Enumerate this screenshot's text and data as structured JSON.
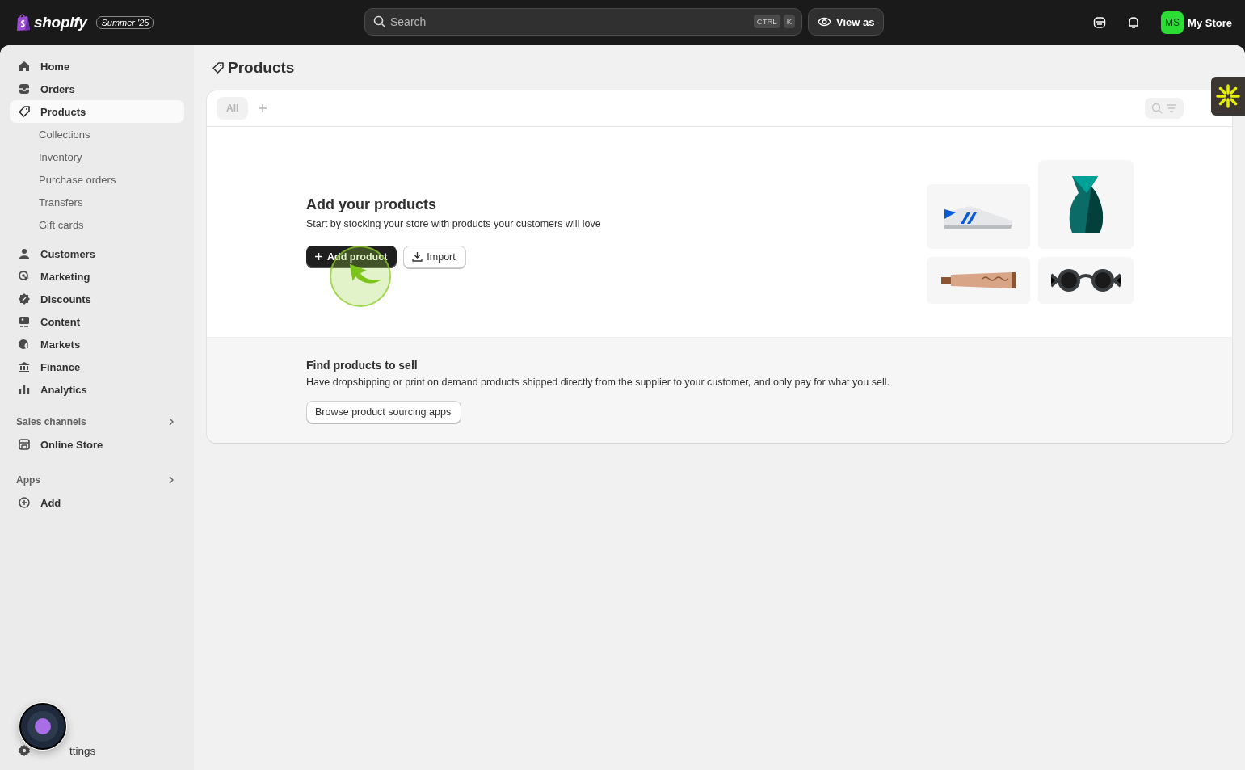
{
  "topbar": {
    "logo_text": "shopify",
    "edition_badge": "Summer '25",
    "search": {
      "placeholder": "Search"
    },
    "shortcut_keys": [
      "CTRL",
      "K"
    ],
    "view_as": "View as",
    "avatar_initials": "MS",
    "store_name": "My Store"
  },
  "sidebar": {
    "items": [
      {
        "label": "Home",
        "selected": false
      },
      {
        "label": "Orders",
        "selected": false
      },
      {
        "label": "Products",
        "selected": true,
        "children": [
          {
            "label": "Collections",
            "selected": false
          },
          {
            "label": "Inventory",
            "selected": false
          },
          {
            "label": "Purchase orders",
            "selected": false
          },
          {
            "label": "Transfers",
            "selected": false
          },
          {
            "label": "Gift cards",
            "selected": false
          }
        ]
      },
      {
        "label": "Customers",
        "selected": false
      },
      {
        "label": "Marketing",
        "selected": false
      },
      {
        "label": "Discounts",
        "selected": false
      },
      {
        "label": "Content",
        "selected": false
      },
      {
        "label": "Markets",
        "selected": false
      },
      {
        "label": "Finance",
        "selected": false
      },
      {
        "label": "Analytics",
        "selected": false
      }
    ],
    "sections": [
      {
        "title": "Sales channels",
        "items": [
          {
            "label": "Online Store",
            "selected": false
          }
        ]
      },
      {
        "title": "Apps",
        "items": [
          {
            "label": "Add",
            "selected": false
          }
        ]
      }
    ],
    "footer_item": {
      "label": "ttings"
    }
  },
  "page": {
    "title": "Products",
    "card": {
      "tabs": [
        {
          "label": "All",
          "selected": true
        }
      ],
      "empty_state": {
        "heading": "Add your products",
        "text": "Start by stocking your store with products your customers will love",
        "buttons": [
          {
            "label": "Add product",
            "kind": "primary"
          },
          {
            "label": "Import",
            "kind": "secondary"
          }
        ]
      },
      "sourcing": {
        "heading": "Find products to sell",
        "text": "Have dropshipping or print on demand products shipped directly from the supplier to your customer, and only pay for what you sell.",
        "button": "Browse product sourcing apps"
      }
    }
  }
}
